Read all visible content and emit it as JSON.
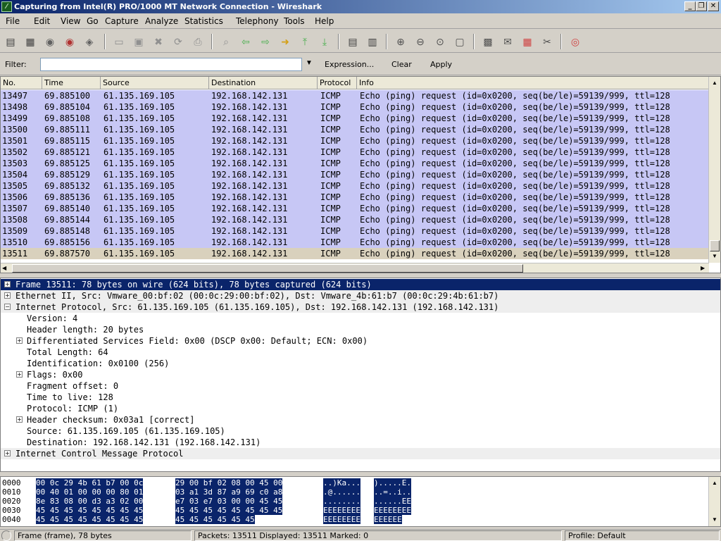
{
  "window": {
    "title": "Capturing from Intel(R) PRO/1000 MT Network Connection - Wireshark",
    "minimize": "_",
    "maximize": "❐",
    "close": "✕"
  },
  "menu": [
    "File",
    "Edit",
    "View",
    "Go",
    "Capture",
    "Analyze",
    "Statistics",
    "Telephony",
    "Tools",
    "Help"
  ],
  "toolbar": {
    "icons": [
      {
        "name": "interfaces-icon",
        "glyph": "▤",
        "color": "#404040"
      },
      {
        "name": "options-icon",
        "glyph": "▦",
        "color": "#404040"
      },
      {
        "name": "start-capture-icon",
        "glyph": "◉",
        "color": "#606060"
      },
      {
        "name": "stop-capture-icon",
        "glyph": "◉",
        "color": "#b03030"
      },
      {
        "name": "restart-capture-icon",
        "glyph": "◈",
        "color": "#606060"
      },
      {
        "name": "open-icon",
        "glyph": "▭",
        "color": "#909090"
      },
      {
        "name": "save-icon",
        "glyph": "▣",
        "color": "#909090"
      },
      {
        "name": "close-file-icon",
        "glyph": "✖",
        "color": "#909090"
      },
      {
        "name": "reload-icon",
        "glyph": "⟳",
        "color": "#909090"
      },
      {
        "name": "print-icon",
        "glyph": "⎙",
        "color": "#909090"
      },
      {
        "name": "find-icon",
        "glyph": "⌕",
        "color": "#909090"
      },
      {
        "name": "back-icon",
        "glyph": "⇦",
        "color": "#4caf50"
      },
      {
        "name": "forward-icon",
        "glyph": "⇨",
        "color": "#4caf50"
      },
      {
        "name": "goto-icon",
        "glyph": "➜",
        "color": "#d4a017"
      },
      {
        "name": "first-packet-icon",
        "glyph": "⤒",
        "color": "#4caf50"
      },
      {
        "name": "last-packet-icon",
        "glyph": "⤓",
        "color": "#4caf50"
      },
      {
        "name": "colorize-icon",
        "glyph": "▤",
        "color": "#404040"
      },
      {
        "name": "autoscroll-icon",
        "glyph": "▥",
        "color": "#404040"
      },
      {
        "name": "zoom-in-icon",
        "glyph": "⊕",
        "color": "#505050"
      },
      {
        "name": "zoom-out-icon",
        "glyph": "⊖",
        "color": "#505050"
      },
      {
        "name": "zoom-normal-icon",
        "glyph": "⊙",
        "color": "#505050"
      },
      {
        "name": "resize-columns-icon",
        "glyph": "▢",
        "color": "#505050"
      },
      {
        "name": "capture-filters-icon",
        "glyph": "▩",
        "color": "#505050"
      },
      {
        "name": "display-filters-icon",
        "glyph": "✉",
        "color": "#505050"
      },
      {
        "name": "coloring-rules-icon",
        "glyph": "▦",
        "color": "#d04040"
      },
      {
        "name": "preferences-icon",
        "glyph": "✂",
        "color": "#505050"
      },
      {
        "name": "help-icon",
        "glyph": "◎",
        "color": "#d04040"
      }
    ]
  },
  "filter": {
    "label": "Filter:",
    "value": "",
    "expression": "Expression...",
    "clear": "Clear",
    "apply": "Apply"
  },
  "packet_list": {
    "columns": [
      "No.",
      "Time",
      "Source",
      "Destination",
      "Protocol",
      "Info"
    ],
    "rows": [
      {
        "no": "13497",
        "time": "69.885100",
        "src": "61.135.169.105",
        "dst": "192.168.142.131",
        "proto": "ICMP",
        "info": "Echo (ping) request  (id=0x0200, seq(be/le)=59139/999, ttl=128"
      },
      {
        "no": "13498",
        "time": "69.885104",
        "src": "61.135.169.105",
        "dst": "192.168.142.131",
        "proto": "ICMP",
        "info": "Echo (ping) request  (id=0x0200, seq(be/le)=59139/999, ttl=128"
      },
      {
        "no": "13499",
        "time": "69.885108",
        "src": "61.135.169.105",
        "dst": "192.168.142.131",
        "proto": "ICMP",
        "info": "Echo (ping) request  (id=0x0200, seq(be/le)=59139/999, ttl=128"
      },
      {
        "no": "13500",
        "time": "69.885111",
        "src": "61.135.169.105",
        "dst": "192.168.142.131",
        "proto": "ICMP",
        "info": "Echo (ping) request  (id=0x0200, seq(be/le)=59139/999, ttl=128"
      },
      {
        "no": "13501",
        "time": "69.885115",
        "src": "61.135.169.105",
        "dst": "192.168.142.131",
        "proto": "ICMP",
        "info": "Echo (ping) request  (id=0x0200, seq(be/le)=59139/999, ttl=128"
      },
      {
        "no": "13502",
        "time": "69.885121",
        "src": "61.135.169.105",
        "dst": "192.168.142.131",
        "proto": "ICMP",
        "info": "Echo (ping) request  (id=0x0200, seq(be/le)=59139/999, ttl=128"
      },
      {
        "no": "13503",
        "time": "69.885125",
        "src": "61.135.169.105",
        "dst": "192.168.142.131",
        "proto": "ICMP",
        "info": "Echo (ping) request  (id=0x0200, seq(be/le)=59139/999, ttl=128"
      },
      {
        "no": "13504",
        "time": "69.885129",
        "src": "61.135.169.105",
        "dst": "192.168.142.131",
        "proto": "ICMP",
        "info": "Echo (ping) request  (id=0x0200, seq(be/le)=59139/999, ttl=128"
      },
      {
        "no": "13505",
        "time": "69.885132",
        "src": "61.135.169.105",
        "dst": "192.168.142.131",
        "proto": "ICMP",
        "info": "Echo (ping) request  (id=0x0200, seq(be/le)=59139/999, ttl=128"
      },
      {
        "no": "13506",
        "time": "69.885136",
        "src": "61.135.169.105",
        "dst": "192.168.142.131",
        "proto": "ICMP",
        "info": "Echo (ping) request  (id=0x0200, seq(be/le)=59139/999, ttl=128"
      },
      {
        "no": "13507",
        "time": "69.885140",
        "src": "61.135.169.105",
        "dst": "192.168.142.131",
        "proto": "ICMP",
        "info": "Echo (ping) request  (id=0x0200, seq(be/le)=59139/999, ttl=128"
      },
      {
        "no": "13508",
        "time": "69.885144",
        "src": "61.135.169.105",
        "dst": "192.168.142.131",
        "proto": "ICMP",
        "info": "Echo (ping) request  (id=0x0200, seq(be/le)=59139/999, ttl=128"
      },
      {
        "no": "13509",
        "time": "69.885148",
        "src": "61.135.169.105",
        "dst": "192.168.142.131",
        "proto": "ICMP",
        "info": "Echo (ping) request  (id=0x0200, seq(be/le)=59139/999, ttl=128"
      },
      {
        "no": "13510",
        "time": "69.885156",
        "src": "61.135.169.105",
        "dst": "192.168.142.131",
        "proto": "ICMP",
        "info": "Echo (ping) request  (id=0x0200, seq(be/le)=59139/999, ttl=128"
      },
      {
        "no": "13511",
        "time": "69.887570",
        "src": "61.135.169.105",
        "dst": "192.168.142.131",
        "proto": "ICMP",
        "info": "Echo (ping) request  (id=0x0200, seq(be/le)=59139/999, ttl=128",
        "selected": true
      }
    ]
  },
  "details": [
    {
      "indent": 0,
      "expander": "+",
      "text": "Frame 13511: 78 bytes on wire (624 bits), 78 bytes captured (624 bits)",
      "selected": true,
      "section": true
    },
    {
      "indent": 0,
      "expander": "+",
      "text": "Ethernet II, Src: Vmware_00:bf:02 (00:0c:29:00:bf:02), Dst: Vmware_4b:61:b7 (00:0c:29:4b:61:b7)",
      "section": true
    },
    {
      "indent": 0,
      "expander": "−",
      "text": "Internet Protocol, Src: 61.135.169.105 (61.135.169.105), Dst: 192.168.142.131 (192.168.142.131)",
      "section": true
    },
    {
      "indent": 1,
      "expander": "",
      "text": "Version: 4"
    },
    {
      "indent": 1,
      "expander": "",
      "text": "Header length: 20 bytes"
    },
    {
      "indent": 1,
      "expander": "+",
      "text": "Differentiated Services Field: 0x00 (DSCP 0x00: Default; ECN: 0x00)"
    },
    {
      "indent": 1,
      "expander": "",
      "text": "Total Length: 64"
    },
    {
      "indent": 1,
      "expander": "",
      "text": "Identification: 0x0100 (256)"
    },
    {
      "indent": 1,
      "expander": "+",
      "text": "Flags: 0x00"
    },
    {
      "indent": 1,
      "expander": "",
      "text": "Fragment offset: 0"
    },
    {
      "indent": 1,
      "expander": "",
      "text": "Time to live: 128"
    },
    {
      "indent": 1,
      "expander": "",
      "text": "Protocol: ICMP (1)"
    },
    {
      "indent": 1,
      "expander": "+",
      "text": "Header checksum: 0x03a1 [correct]"
    },
    {
      "indent": 1,
      "expander": "",
      "text": "Source: 61.135.169.105 (61.135.169.105)"
    },
    {
      "indent": 1,
      "expander": "",
      "text": "Destination: 192.168.142.131 (192.168.142.131)"
    },
    {
      "indent": 0,
      "expander": "+",
      "text": "Internet Control Message Protocol",
      "section": true
    }
  ],
  "bytes": [
    {
      "offset": "0000",
      "hex1": "00 0c 29 4b 61 b7 00 0c",
      "hex2": "29 00 bf 02 08 00 45 00",
      "asc1": "..)Ka...",
      "asc2": ").....E."
    },
    {
      "offset": "0010",
      "hex1": "00 40 01 00 00 00 80 01",
      "hex2": "03 a1 3d 87 a9 69 c0 a8",
      "asc1": ".@......",
      "asc2": "..=..i.."
    },
    {
      "offset": "0020",
      "hex1": "8e 83 08 00 d3 a3 02 00",
      "hex2": "e7 03 e7 03 00 00 45 45",
      "asc1": "........",
      "asc2": "......EE"
    },
    {
      "offset": "0030",
      "hex1": "45 45 45 45 45 45 45 45",
      "hex2": "45 45 45 45 45 45 45 45",
      "asc1": "EEEEEEEE",
      "asc2": "EEEEEEEE"
    },
    {
      "offset": "0040",
      "hex1": "45 45 45 45 45 45 45 45",
      "hex2": "45 45 45 45 45 45",
      "asc1": "EEEEEEEE",
      "asc2": "EEEEEE"
    }
  ],
  "status": {
    "frame": "Frame (frame), 78 bytes",
    "packets": "Packets: 13511 Displayed: 13511 Marked: 0",
    "profile": "Profile: Default"
  }
}
